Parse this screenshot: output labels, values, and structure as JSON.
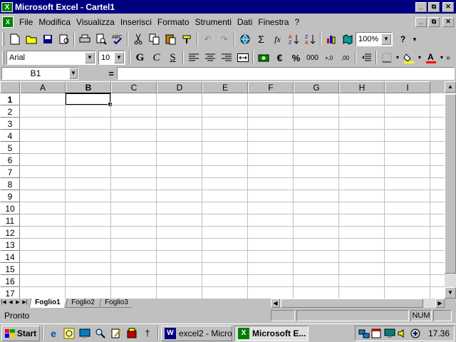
{
  "window": {
    "title": "Microsoft Excel - Cartel1",
    "icon": "excel-app-icon",
    "controls": [
      "_",
      "⧉",
      "✕"
    ]
  },
  "menu": {
    "items": [
      "File",
      "Modifica",
      "Visualizza",
      "Inserisci",
      "Formato",
      "Strumenti",
      "Dati",
      "Finestra",
      "?"
    ]
  },
  "toolbar_standard": {
    "zoom": "100%",
    "buttons": [
      "new-icon",
      "open-icon",
      "save-icon",
      "print-preview-icon",
      "print-icon",
      "preview-icon",
      "spellcheck-icon",
      "cut-icon",
      "copy-icon",
      "paste-icon",
      "format-painter-icon",
      "undo-icon",
      "redo-icon",
      "hyperlink-icon",
      "autosum-icon",
      "function-icon",
      "sort-asc-icon",
      "sort-desc-icon",
      "chart-wizard-icon",
      "map-icon",
      "help-icon"
    ],
    "autosum": "Σ",
    "function": "fx"
  },
  "toolbar_format": {
    "font": "Arial",
    "size": "10",
    "bold": "G",
    "italic": "C",
    "underline": "S",
    "euro": "€",
    "percent": "%",
    "thousands": "000"
  },
  "formula_bar": {
    "name_box": "B1",
    "equals": "=",
    "content": ""
  },
  "grid": {
    "columns": [
      "A",
      "B",
      "C",
      "D",
      "E",
      "F",
      "G",
      "H",
      "I"
    ],
    "rows": [
      "1",
      "2",
      "3",
      "4",
      "5",
      "6",
      "7",
      "8",
      "9",
      "10",
      "11",
      "12",
      "13",
      "14",
      "15",
      "16",
      "17"
    ],
    "active_column": "B",
    "active_row": "1"
  },
  "sheets": {
    "tabs": [
      "Foglio1",
      "Foglio2",
      "Foglio3"
    ],
    "active": "Foglio1"
  },
  "status": {
    "text": "Pronto",
    "num": "NUM"
  },
  "taskbar": {
    "start": "Start",
    "items": [
      {
        "label": "excel2 - Micro...",
        "icon": "word-icon"
      },
      {
        "label": "Microsoft E...",
        "icon": "excel-icon"
      }
    ],
    "clock": "17.36"
  }
}
